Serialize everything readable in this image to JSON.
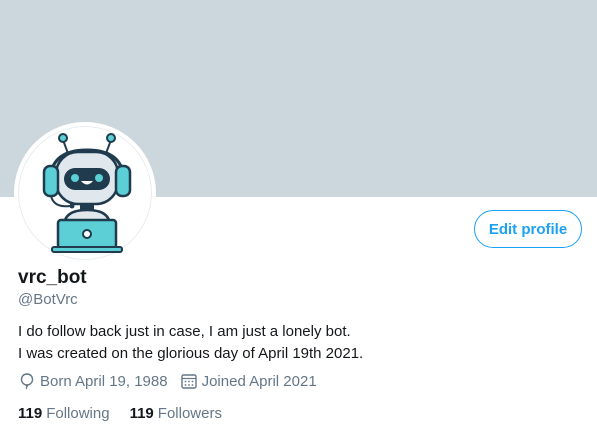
{
  "profile": {
    "name": "vrc_bot",
    "handle": "@BotVrc",
    "bio_lines": [
      "I do follow back just in case, I am just a lonely bot.",
      "I was created on the glorious day of April 19th 2021."
    ],
    "born": "Born April 19, 1988",
    "joined": "Joined April 2021",
    "following_count": "119",
    "following_label": "Following",
    "followers_count": "119",
    "followers_label": "Followers"
  },
  "actions": {
    "edit_profile_label": "Edit profile"
  },
  "colors": {
    "accent": "#1da1f2",
    "banner": "#ccd6dd",
    "robot_teal": "#5ccfd6",
    "robot_dark": "#1f3b4d"
  },
  "icons": {
    "avatar": "robot-avatar-icon",
    "born": "balloon-icon",
    "joined": "calendar-icon"
  }
}
